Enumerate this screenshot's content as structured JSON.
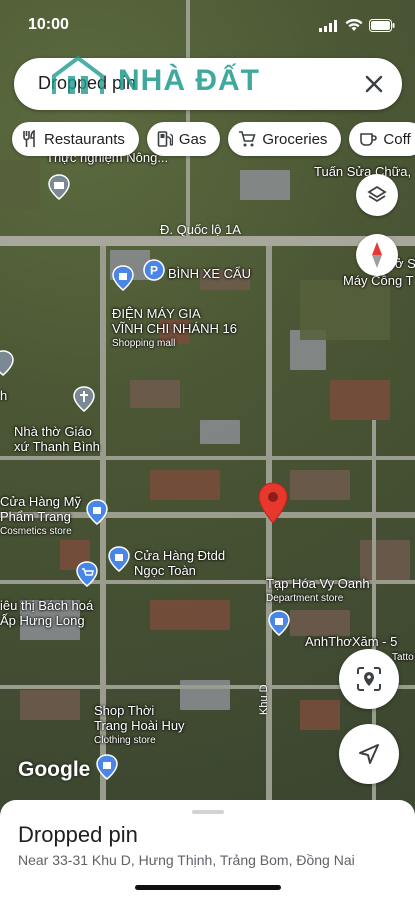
{
  "status_bar": {
    "time": "10:00"
  },
  "search": {
    "value": "Dropped pin"
  },
  "watermark": {
    "text": "NHÀ ĐẤT"
  },
  "chips": [
    {
      "label": "Restaurants",
      "icon": "fork-knife-icon"
    },
    {
      "label": "Gas",
      "icon": "gas-pump-icon"
    },
    {
      "label": "Groceries",
      "icon": "cart-icon"
    },
    {
      "label": "Coff",
      "icon": "coffee-icon"
    }
  ],
  "map": {
    "road_name": "Đ. Quốc lộ 1A",
    "road_name_2": "Khu D",
    "labels": {
      "thuc_nghiem": "Thực nghiệm Nông...",
      "tuan_sua": "Tuấn Sửa Chữa,",
      "binh_xe_cau": "BÌNH XE CẨU",
      "dien_may_1": "ĐIỆN MÁY GIA",
      "dien_may_2": "VĨNH CHI NHÁNH 16",
      "dien_may_sub": "Shopping mall",
      "may_cong": "Máy Công T",
      "o_s": "ở S",
      "nha_tho_1": "Nhà thờ Giáo",
      "nha_tho_2": "xứ Thanh Bình",
      "h_label": "h",
      "my_pham_1": "Cửa Hàng Mỹ",
      "my_pham_2": "Phẩm Trang",
      "my_pham_sub": "Cosmetics store",
      "dtdd_1": "Cửa Hàng Đtdd",
      "dtdd_2": "Ngọc Toàn",
      "sieu_thi_1": "iêu thị Bách hoá",
      "sieu_thi_2": "Ấp Hưng Long",
      "tap_hoa": "Tạp Hóa Vy Oanh",
      "tap_hoa_sub": "Department store",
      "anh_tho": "AnhThơXăm - 5",
      "tatto": "Tatto",
      "shop_1": "Shop Thời",
      "shop_2": "Trang Hoài Huy",
      "shop_sub": "Clothing store"
    },
    "google_logo": "Google"
  },
  "sheet": {
    "title": "Dropped pin",
    "address": "Near 33-31 Khu D, Hưng Thịnh, Trảng Bom, Đồng Nai"
  },
  "colors": {
    "pin": "#e8372c",
    "poi_blue": "#4a86e8",
    "compass_red": "#e53935"
  }
}
